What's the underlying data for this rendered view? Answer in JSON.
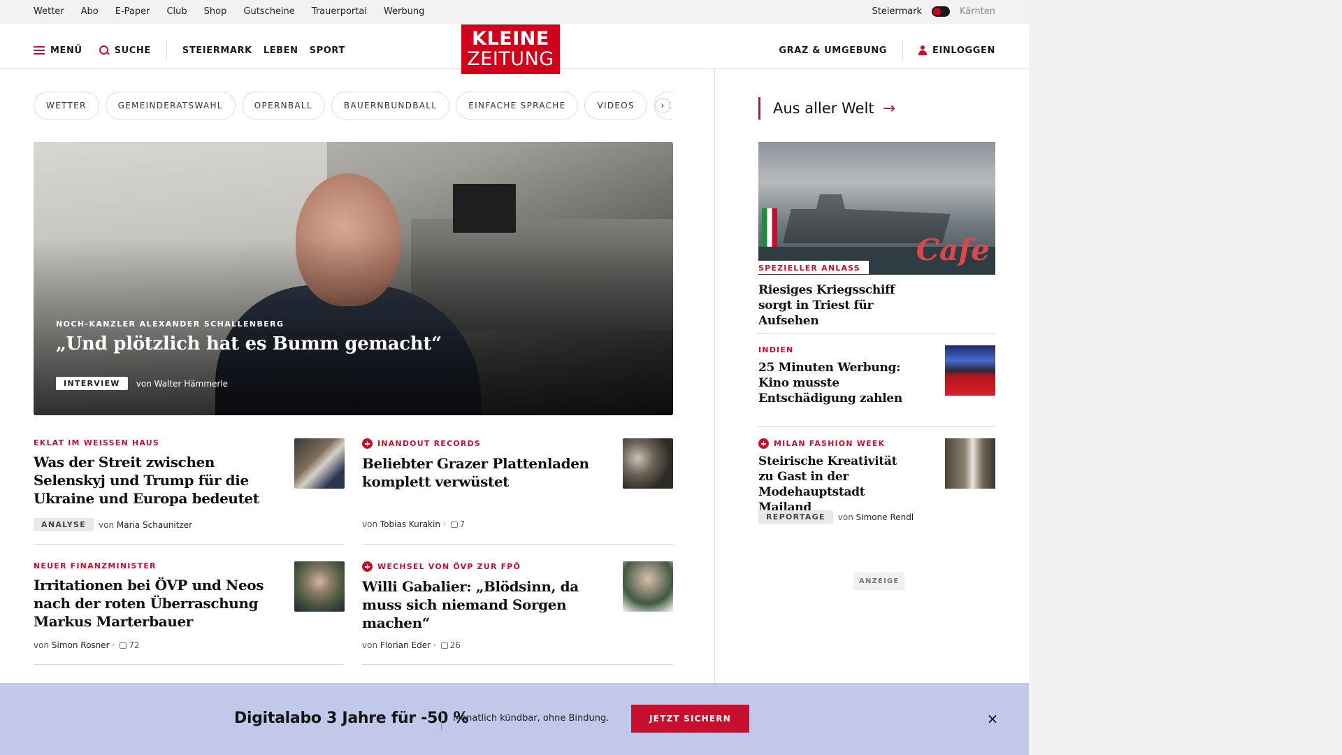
{
  "topbar": {
    "links": [
      "Wetter",
      "Abo",
      "E-Paper",
      "Club",
      "Shop",
      "Gutscheine",
      "Trauerportal",
      "Werbung"
    ],
    "region_active": "Steiermark",
    "region_inactive": "Kärnten"
  },
  "nav": {
    "menu": "MENÜ",
    "search": "SUCHE",
    "sections": [
      "STEIERMARK",
      "LEBEN",
      "SPORT"
    ],
    "logo_line1": "KLEINE",
    "logo_line2": "ZEITUNG",
    "local": "GRAZ & UMGEBUNG",
    "login": "EINLOGGEN"
  },
  "tags": [
    "WETTER",
    "GEMEINDERATSWAHL",
    "OPERNBALL",
    "BAUERNBUNDBALL",
    "EINFACHE SPRACHE",
    "VIDEOS",
    "K"
  ],
  "hero": {
    "kicker": "NOCH-KANZLER ALEXANDER SCHALLENBERG",
    "title": "„Und plötzlich hat es Bumm gemacht“",
    "badge": "INTERVIEW",
    "author_prefix": "von",
    "author": "Walter Hämmerle"
  },
  "articles": [
    {
      "kicker": "EKLAT IM WEISSEN HAUS",
      "plus": false,
      "title": "Was der Streit zwischen Selenskyj und Trump für die Ukraine und Europa bedeutet",
      "badge": "ANALYSE",
      "author": "Maria Schaunitzer",
      "comments": ""
    },
    {
      "kicker": "INANDOUT RECORDS",
      "plus": true,
      "title": "Beliebter Grazer Plattenladen komplett verwüstet",
      "badge": "",
      "author": "Tobias Kurakin",
      "comments": "7"
    },
    {
      "kicker": "NEUER FINANZMINISTER",
      "plus": false,
      "title": "Irritationen bei ÖVP und Neos nach der roten Überraschung Markus Marterbauer",
      "badge": "",
      "author": "Simon Rosner",
      "comments": "72"
    },
    {
      "kicker": "WECHSEL VON ÖVP ZUR FPÖ",
      "plus": true,
      "title": "Willi Gabalier: „Blödsinn, da muss sich niemand Sorgen machen“",
      "badge": "",
      "author": "Florian Eder",
      "comments": "26"
    }
  ],
  "sidebar": {
    "heading": "Aus aller Welt",
    "image_text": "Cafe",
    "lead_kicker": "SPEZIELLER ANLASS",
    "lead_title": "Riesiges Kriegsschiff sorgt in Triest für Aufsehen",
    "items": [
      {
        "kicker": "INDIEN",
        "plus": false,
        "title": "25 Minuten Werbung: Kino musste Entschädigung zahlen",
        "badge": "",
        "author": ""
      },
      {
        "kicker": "MILAN FASHION WEEK",
        "plus": true,
        "title": "Steirische Kreativität zu Gast in der Modehauptstadt Mailand",
        "badge": "REPORTAGE",
        "author": "Simone Rendl"
      }
    ],
    "ad_label": "ANZEIGE"
  },
  "promo": {
    "title": "Digitalabo 3 Jahre für -50 %",
    "subtitle": "Monatlich kündbar, ohne Bindung.",
    "button": "JETZT SICHERN",
    "close": "×"
  },
  "colors": {
    "brand_red": "#d0021b",
    "accent_red": "#c8102e",
    "promo_bg": "#c2c8ea"
  }
}
